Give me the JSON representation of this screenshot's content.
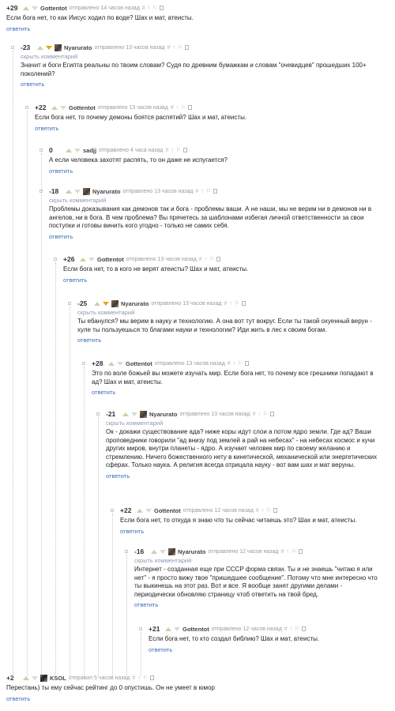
{
  "strings": {
    "reply": "ответить",
    "hidden": "скрыть комментарий"
  },
  "comments": [
    {
      "depth": 0,
      "rating": "+29",
      "vote": "",
      "avatar": false,
      "author": "Gottentot",
      "posted": "отправлено 14 часов назад",
      "hidden": false,
      "text": "Если бога нет, то как Иисус ходил по воде? Шах и мат, атеисты."
    },
    {
      "depth": 1,
      "rating": "-23",
      "vote": "down",
      "avatar": true,
      "author": "Nyarurato",
      "posted": "отправлено 13 часов назад",
      "hidden": true,
      "text": "Значит и боги Египта реальны по твоим словам? Судя по древним бумажкам и словам \"очевидцев\" прошедших 100+ поколений?"
    },
    {
      "depth": 2,
      "rating": "+22",
      "vote": "",
      "avatar": false,
      "author": "Gottentot",
      "posted": "отправлено 13 часов назад",
      "hidden": false,
      "text": "Если бога нет, то почему демоны боятся распятий? Шах и мат, атеисты."
    },
    {
      "depth": 3,
      "rating": "0",
      "vote": "",
      "avatar": false,
      "author": "sadjj",
      "posted": "отправлено 4 часа назад",
      "hidden": false,
      "text": "А если человека захотят распять, то он даже не испугается?"
    },
    {
      "depth": 3,
      "rating": "-18",
      "vote": "",
      "avatar": true,
      "author": "Nyarurato",
      "posted": "отправлено 13 часов назад",
      "hidden": true,
      "text": "Проблемы доказывания как демонов так и бога - проблемы ваши. А не наши, мы не верим ни в демонов ни в ангелов, ни в бога. В чем проблема? Вы прячетесь за шаблонами избегая личной ответственности за свои поступки и готовы винить кого угодно - только не самих себя."
    },
    {
      "depth": 4,
      "rating": "+26",
      "vote": "",
      "avatar": false,
      "author": "Gottentot",
      "posted": "отправлено 13 часов назад",
      "hidden": false,
      "text": "Если бога нет, то в кого не верят атеисты? Шах и мат, атеисты."
    },
    {
      "depth": 5,
      "rating": "-25",
      "vote": "down",
      "avatar": true,
      "author": "Nyarurato",
      "posted": "отправлено 13 часов назад",
      "hidden": true,
      "text": "Ты ебанулся? мы верим в науку и технологию. А она вот тут вокруг. Если ты такой охуенный верун - хуле ты пользуешься то благами науки и технологии? Иди жить в лес к своим богам."
    },
    {
      "depth": 6,
      "rating": "+28",
      "vote": "",
      "avatar": false,
      "author": "Gottentot",
      "posted": "отправлено 13 часов назад",
      "hidden": false,
      "text": "Это по воле божьей вы можете изучать мир. Если бога нет, то почему все грешники попадают в ад? Шах и мат, атеисты."
    },
    {
      "depth": 7,
      "rating": "-21",
      "vote": "",
      "avatar": true,
      "author": "Nyarurato",
      "posted": "отправлено 13 часов назад",
      "hidden": true,
      "text": "Ок - докажи существование ада? ниже коры идут слои а потом ядро земли. Где ад? Ваши проповедники говорили \"ад внизу под землей а рай на небесах\" - на небесах космос и кучи других миров, внутри планеты - ядро. А изучает человек мир по своему желанию и стремлению. Ничего божественного нету в кинетической, механической или энергетических сферах. Только наука. А религия всегда отрицала науку - вот вам шах и мат веруны."
    },
    {
      "depth": 8,
      "rating": "+22",
      "vote": "",
      "avatar": false,
      "author": "Gottentot",
      "posted": "отправлено 12 часов назад",
      "hidden": false,
      "text": "Если бога нет, то откуда я знаю что ты сейчас читаешь это? Шах и мат, атеисты."
    },
    {
      "depth": 9,
      "rating": "-16",
      "vote": "",
      "avatar": true,
      "author": "Nyarurato",
      "posted": "отправлено 12 часов назад",
      "hidden": true,
      "text": "Интернет - созданная еще при СССР форма связи. Ты и не знаешь \"читаю я или нет\" - я просто вижу твое \"пришедшее сообщение\". Потому что мне интересно что ты выкинешь на этот раз. Вот и все. Я вообще занят другими делами - периодически обновляю страницу чтоб ответить на твой бред."
    },
    {
      "depth": 10,
      "rating": "+21",
      "vote": "",
      "avatar": false,
      "author": "Gottentot",
      "posted": "отправлено 12 часов назад",
      "hidden": false,
      "text": "Если бога нет, то кто создал библию? Шах и мат, атеисты."
    },
    {
      "depth": 0,
      "rating": "+2",
      "vote": "",
      "avatar": true,
      "avatarStyle": "k",
      "author": "KSOL",
      "posted": "отправил 5 часов назад",
      "hidden": false,
      "text": "Перестань) ты ему сейчас рейтинг до 0 опустишь. Он не умеет в юмор"
    }
  ]
}
